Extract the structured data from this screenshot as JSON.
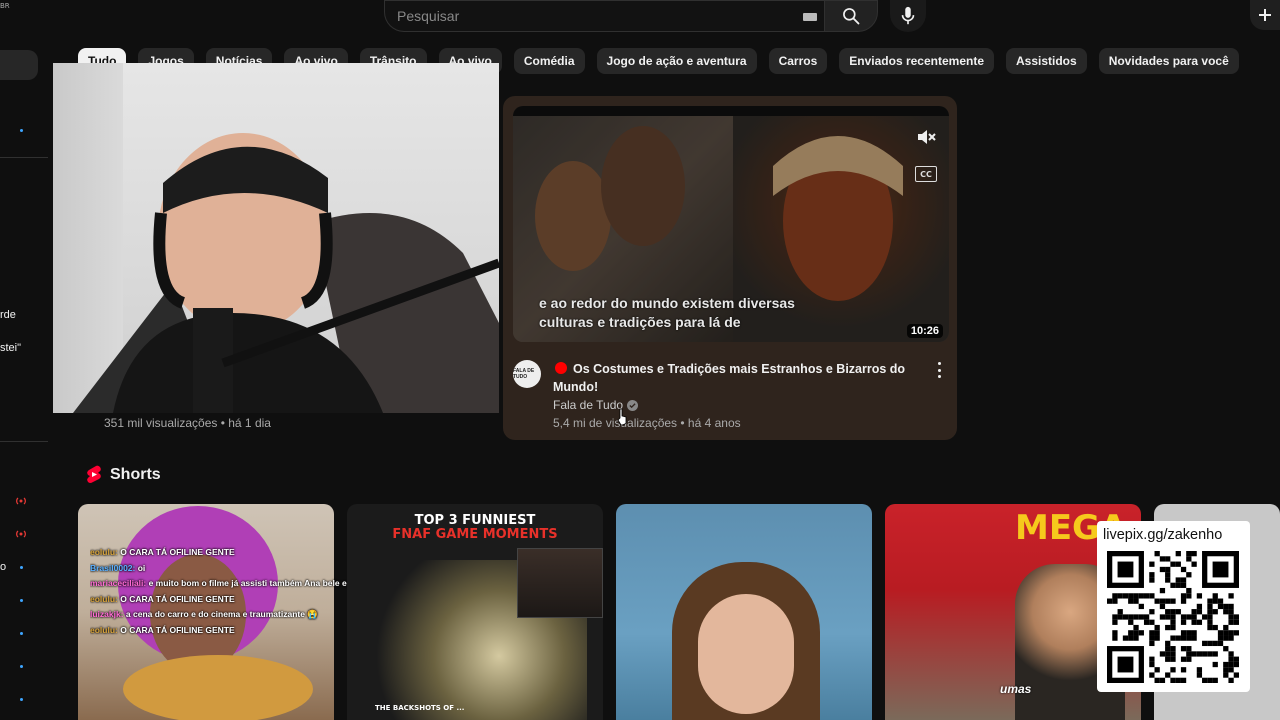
{
  "header": {
    "region_code": "BR",
    "search_placeholder": "Pesquisar"
  },
  "chips": [
    {
      "label": "Tudo",
      "active": true
    },
    {
      "label": "Jogos"
    },
    {
      "label": "Notícias"
    },
    {
      "label": "Ao vivo"
    },
    {
      "label": "Trânsito"
    },
    {
      "label": "Ao vivo"
    },
    {
      "label": "Comédia"
    },
    {
      "label": "Jogo de ação e aventura"
    },
    {
      "label": "Carros"
    },
    {
      "label": "Enviados recentemente"
    },
    {
      "label": "Assistidos"
    },
    {
      "label": "Novidades para você"
    }
  ],
  "sidebar": {
    "fragment_1": "rde",
    "fragment_2": "stei\"",
    "fragment_3": "o"
  },
  "previous_video": {
    "meta": "351 mil visualizações • há 1 dia"
  },
  "hovered_video": {
    "caption_line_1": "e ao redor do mundo existem diversas",
    "caption_line_2": "culturas e tradições para lá de",
    "duration": "10:26",
    "title": "Os Costumes e Tradições mais Estranhos e Bizarros do Mundo!",
    "channel": "Fala de Tudo",
    "meta": "5,4 mi de visualizações • há 4 anos",
    "avatar_text": "FALA DE TUDO",
    "cc_label": "CC",
    "live_color": "#ff0000",
    "card_bg": "#2f241d"
  },
  "shorts": {
    "title": "Shorts",
    "items": [
      {
        "name": "short-chat-clip",
        "chat": [
          {
            "user": "eolulu:",
            "text": " O CARA TÁ OFILINE GENTE"
          },
          {
            "user": "Brasil0002:",
            "text": " oi"
          },
          {
            "user": "mariaceciliali:",
            "text": " e muito bom o filme já assisti também Ana bele e fera"
          },
          {
            "user": "eolulu:",
            "text": " O CARA TÁ OFILINE GENTE"
          },
          {
            "user": "luizakjk:",
            "text": " a cena do carro e do cinema e traumatizante 😭"
          },
          {
            "user": "eolulu:",
            "text": " O CARA TÁ OFILINE GENTE"
          }
        ]
      },
      {
        "name": "short-fnaf",
        "banner_line_1": "TOP 3 FUNNIEST",
        "banner_line_2": "FNAF GAME MOMENTS",
        "footer": "THE BACKSHOTS OF ..."
      },
      {
        "name": "short-portrait"
      },
      {
        "name": "short-mega",
        "sign": "MEGA",
        "subtitle": "umas"
      },
      {
        "name": "short-partial"
      }
    ]
  },
  "livepix": {
    "url": "livepix.gg/zakenho"
  },
  "colors": {
    "background": "#0f0f0f",
    "chip_bg": "#272727",
    "accent_red": "#ff0000"
  }
}
